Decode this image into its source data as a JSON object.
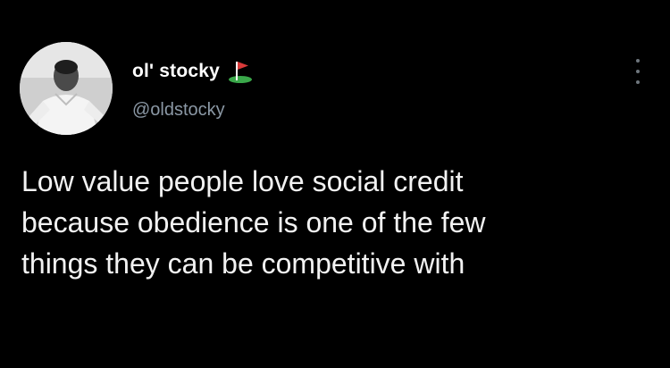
{
  "author": {
    "display_name": "ol' stocky",
    "handle": "@oldstocky",
    "badge_icon": "golf-flag-icon",
    "avatar_description": "profile-photo"
  },
  "more_icon": "more-options-icon",
  "tweet": {
    "lines": [
      "Low value people love social credit",
      "because obedience is one of the few",
      "things they can be competitive with"
    ]
  },
  "colors": {
    "background": "#000000",
    "name": "#ffffff",
    "handle": "#8b98a5",
    "body": "#f2f2f2",
    "flag_green": "#3aa84a",
    "flag_red": "#d93a3a"
  }
}
